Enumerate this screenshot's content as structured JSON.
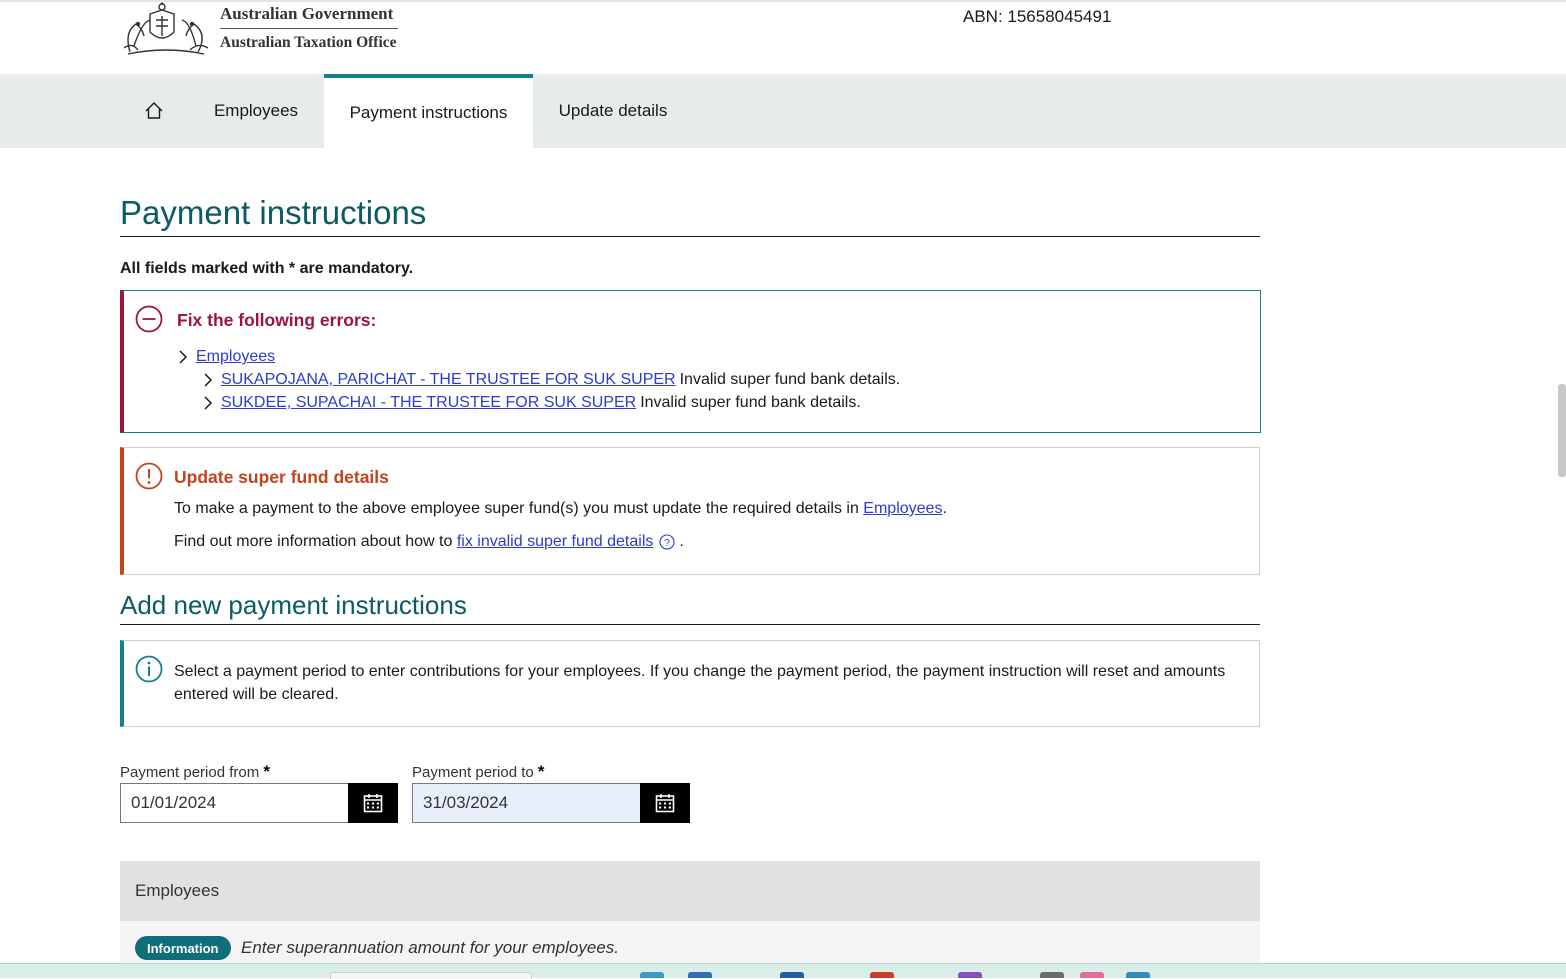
{
  "header": {
    "gov_name": "Australian Government",
    "agency_name": "Australian Taxation Office",
    "abn": "ABN: 15658045491"
  },
  "nav": {
    "home_icon": "home-icon",
    "items": [
      {
        "label": "Employees",
        "active": false
      },
      {
        "label": "Payment instructions",
        "active": true
      },
      {
        "label": "Update details",
        "active": false
      }
    ]
  },
  "page": {
    "title": "Payment instructions",
    "mandatory_note": "All fields marked with * are mandatory."
  },
  "errors": {
    "title": "Fix the following errors:",
    "section_link": "Employees",
    "items": [
      {
        "link": "SUKAPOJANA, PARICHAT - THE TRUSTEE FOR SUK SUPER",
        "message": "Invalid super fund bank details."
      },
      {
        "link": "SUKDEE, SUPACHAI - THE TRUSTEE FOR SUK SUPER",
        "message": "Invalid super fund bank details."
      }
    ]
  },
  "warning": {
    "title": "Update super fund details",
    "p1_text": "To make a payment to the above employee super fund(s) you must update the required details in",
    "p1_link": "Employees",
    "p1_end": ".",
    "p2_text": "Find out more information about how to",
    "p2_link": "fix invalid super fund details",
    "p2_end": "."
  },
  "add_section": {
    "title": "Add new payment instructions",
    "info_text": "Select a payment period to enter contributions for your employees. If you change the payment period, the payment instruction will reset and amounts entered will be cleared."
  },
  "period": {
    "from_label": "Payment period from",
    "from_value": "01/01/2024",
    "to_label": "Payment period to",
    "to_value": "31/03/2024",
    "required_marker": "*"
  },
  "employees_section": {
    "heading": "Employees",
    "badge": "Information",
    "info": "Enter superannuation amount for your employees."
  },
  "colors": {
    "teal": "#13808a",
    "error": "#9b1639",
    "warning": "#c2451e",
    "link": "#2d3ccc"
  }
}
